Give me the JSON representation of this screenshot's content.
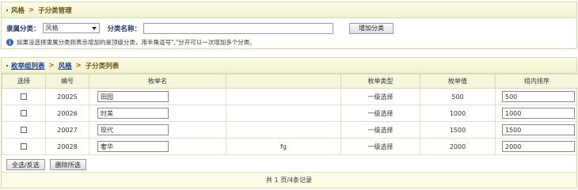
{
  "top": {
    "breadcrumb": [
      "风格",
      "子分类管理"
    ],
    "parent_label": "隶属分类：",
    "parent_selected": "风格",
    "name_label": "分类名称：",
    "name_value": "",
    "add_button": "增加分类",
    "hint": "如果没选择隶属分类则表示增加的是顶级分类，用半角逗号\",\"分开可以一次增加多个分类。"
  },
  "bottom": {
    "breadcrumb": [
      "枚举组列表",
      "风格",
      "子分类列表"
    ],
    "columns": [
      "选择",
      "编号",
      "枚举名",
      "",
      "枚举类型",
      "枚举值",
      "组内排序"
    ],
    "rows": [
      {
        "id": "20025",
        "name": "田园",
        "extra": "",
        "type": "一级选择",
        "value": "500",
        "order": "500"
      },
      {
        "id": "20026",
        "name": "时美",
        "extra": "",
        "type": "一级选择",
        "value": "1000",
        "order": "1000"
      },
      {
        "id": "20027",
        "name": "现代",
        "extra": "",
        "type": "一级选择",
        "value": "1500",
        "order": "1500"
      },
      {
        "id": "20028",
        "name": "奢华",
        "extra": "fg",
        "type": "一级选择",
        "value": "2000",
        "order": "2000"
      }
    ],
    "select_all_button": "全选/反选",
    "delete_button": "删除所选",
    "pager": "共 1 页/4条记录"
  }
}
